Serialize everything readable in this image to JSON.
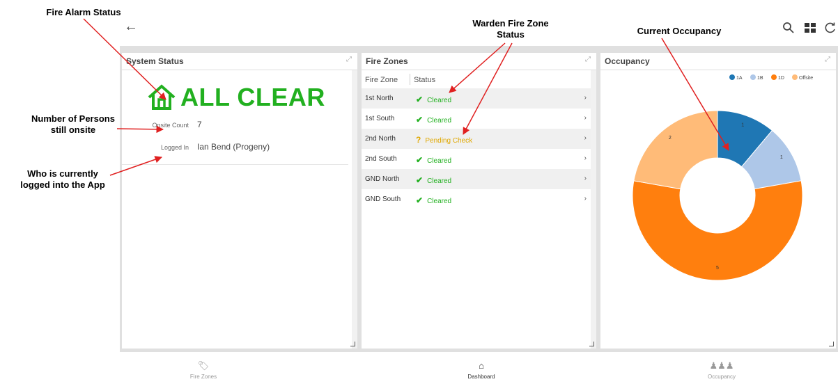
{
  "annotations": {
    "fire_alarm": "Fire Alarm Status",
    "persons_line1": "Number of Persons",
    "persons_line2": "still onsite",
    "logged_line1": "Who is currently",
    "logged_line2": "logged into the App",
    "warden_line1": "Warden Fire Zone",
    "warden_line2": "Status",
    "occupancy": "Current Occupancy"
  },
  "colors": {
    "accent": "#22b020",
    "pending": "#e0a800",
    "annotation_arrow": "#e02020"
  },
  "system_status": {
    "title": "System Status",
    "status_text": "ALL CLEAR",
    "onsite_label": "Onsite Count",
    "onsite_value": "7",
    "logged_label": "Logged In",
    "logged_value": "Ian Bend (Progeny)"
  },
  "fire_zones": {
    "title": "Fire Zones",
    "col_zone": "Fire Zone",
    "col_status": "Status",
    "rows": [
      {
        "zone": "1st North",
        "status": "Cleared",
        "state": "cleared"
      },
      {
        "zone": "1st South",
        "status": "Cleared",
        "state": "cleared"
      },
      {
        "zone": "2nd North",
        "status": "Pending Check",
        "state": "pending"
      },
      {
        "zone": "2nd South",
        "status": "Cleared",
        "state": "cleared"
      },
      {
        "zone": "GND North",
        "status": "Cleared",
        "state": "cleared"
      },
      {
        "zone": "GND South",
        "status": "Cleared",
        "state": "cleared"
      }
    ]
  },
  "occupancy": {
    "title": "Occupancy"
  },
  "chart_data": {
    "type": "pie",
    "donut": true,
    "categories": [
      "1A",
      "1B",
      "1D",
      "Offsite"
    ],
    "values": [
      1,
      1,
      5,
      2
    ],
    "colors": [
      "#1f77b4",
      "#aec7e8",
      "#ff7f0e",
      "#ffbb78"
    ],
    "legend": "top-right"
  },
  "nav": {
    "fire_zones": "Fire Zones",
    "dashboard": "Dashboard",
    "occupancy": "Occupancy"
  }
}
